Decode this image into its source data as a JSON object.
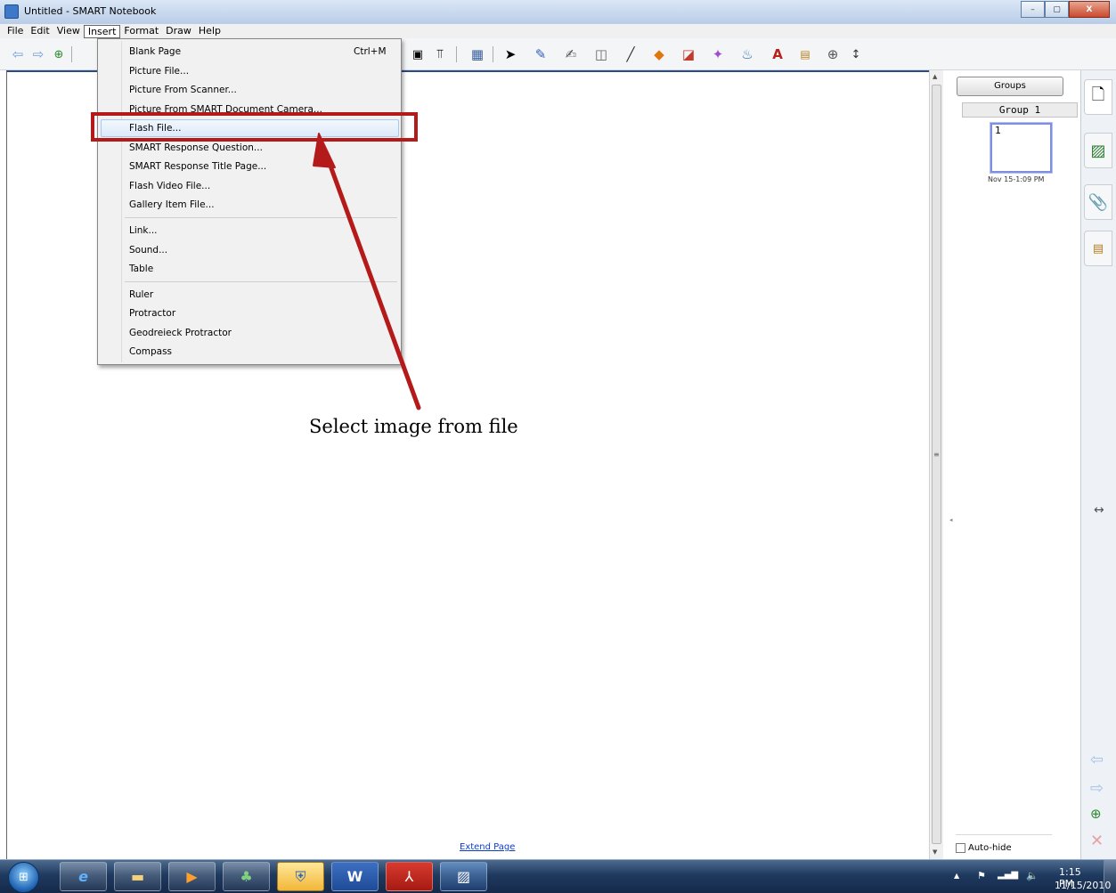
{
  "window": {
    "title": "Untitled - SMART Notebook",
    "controls": {
      "minimize": "–",
      "maximize": "▢",
      "close": "X"
    }
  },
  "menubar": {
    "items": [
      "File",
      "Edit",
      "View",
      "Insert",
      "Format",
      "Draw",
      "Help"
    ],
    "active": "Insert"
  },
  "insert_menu": {
    "items": [
      {
        "label": "Blank Page",
        "shortcut": "Ctrl+M"
      },
      {
        "label": "Picture File..."
      },
      {
        "label": "Picture From Scanner..."
      },
      {
        "label": "Picture From SMART Document Camera..."
      },
      {
        "label": "Flash File..."
      },
      {
        "label": "SMART Response Question..."
      },
      {
        "label": "SMART Response Title Page..."
      },
      {
        "label": "Flash Video File..."
      },
      {
        "label": "Gallery Item File..."
      },
      {
        "label": "Link..."
      },
      {
        "label": "Sound..."
      },
      {
        "label": "Table"
      },
      {
        "label": "Ruler"
      },
      {
        "label": "Protractor"
      },
      {
        "label": "Geodreieck Protractor"
      },
      {
        "label": "Compass"
      }
    ],
    "highlighted": "Flash File..."
  },
  "annotation": {
    "text": "Select image from file",
    "color": "#b51a1a"
  },
  "canvas": {
    "extend_page": "Extend Page"
  },
  "sidebar": {
    "groups_button": "Groups",
    "group_name": "Group 1",
    "page_thumb_number": "1",
    "page_thumb_date": "Nov 15-1:09 PM",
    "autohide_label": "Auto-hide",
    "autohide_checked": false
  },
  "taskbar": {
    "time": "1:15 PM",
    "date": "11/15/2010"
  }
}
